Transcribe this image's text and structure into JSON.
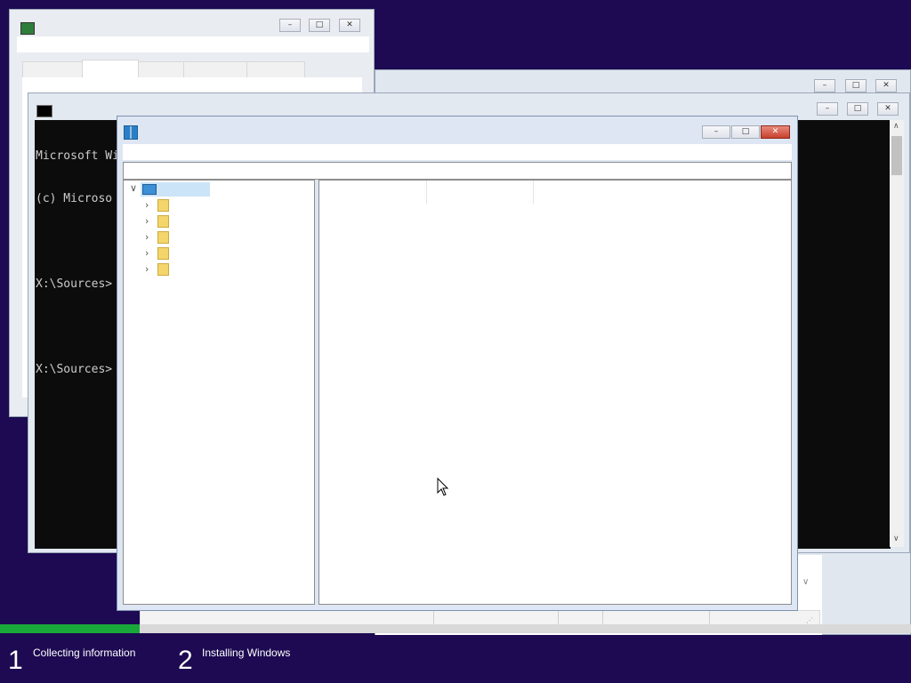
{
  "console": {
    "lines": [
      "Microsoft Wi",
      "(c) Microso",
      "",
      "X:\\Sources>",
      "",
      "X:\\Sources>"
    ]
  },
  "steps": [
    {
      "number": "1",
      "label": "Collecting information"
    },
    {
      "number": "2",
      "label": "Installing Windows"
    }
  ],
  "progress": {
    "fraction": 0.153,
    "color": "#19a83a"
  },
  "colors": {
    "desktop": "#1d0a52",
    "progress": "#19a83a"
  }
}
